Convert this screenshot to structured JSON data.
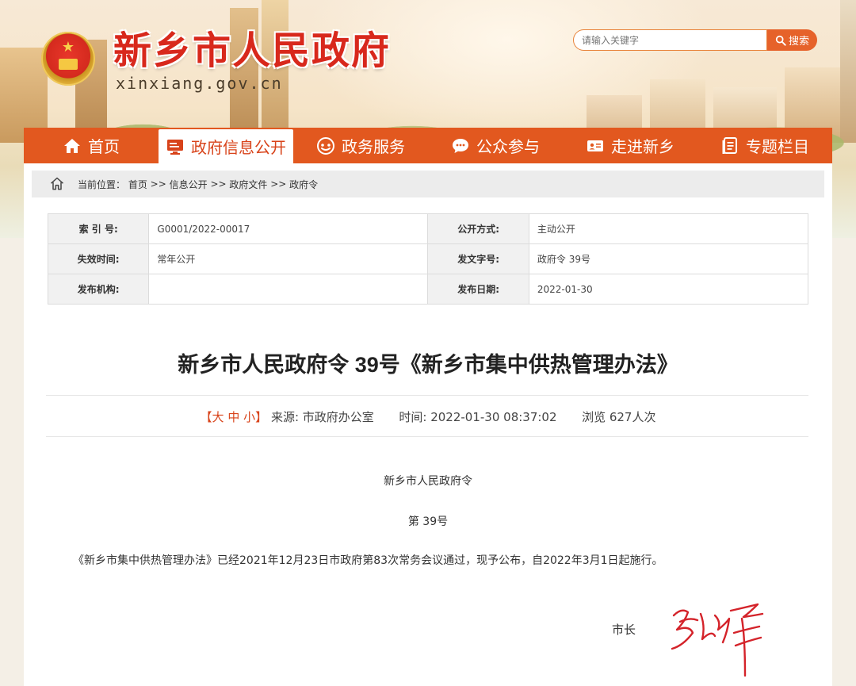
{
  "header": {
    "site_title": "新乡市人民政府",
    "site_domain": "xinxiang.gov.cn",
    "search_placeholder": "请输入关键字",
    "search_button": "搜索"
  },
  "nav": [
    {
      "label": "首页",
      "icon": "home-icon"
    },
    {
      "label": "政府信息公开",
      "icon": "monitor-icon",
      "active": true
    },
    {
      "label": "政务服务",
      "icon": "service-icon"
    },
    {
      "label": "公众参与",
      "icon": "chat-icon"
    },
    {
      "label": "走进新乡",
      "icon": "id-card-icon"
    },
    {
      "label": "专题栏目",
      "icon": "document-icon"
    }
  ],
  "breadcrumb": {
    "prefix": "当前位置：",
    "items": [
      "首页",
      "信息公开",
      "政府文件",
      "政府令"
    ],
    "separator": " >> "
  },
  "meta": {
    "index_label": "索 引 号:",
    "index_value": "G0001/2022-00017",
    "public_mode_label": "公开方式:",
    "public_mode_value": "主动公开",
    "expiry_label": "失效时间:",
    "expiry_value": "常年公开",
    "doc_number_label": "发文字号:",
    "doc_number_value": "政府令 39号",
    "issuer_label": "发布机构:",
    "issuer_value": "",
    "publish_date_label": "发布日期:",
    "publish_date_value": "2022-01-30"
  },
  "article": {
    "title": "新乡市人民政府令 39号《新乡市集中供热管理办法》",
    "font_size_open": "【",
    "font_size_large": "大",
    "font_size_medium": "中",
    "font_size_small": "小",
    "font_size_close": "】",
    "source_label": "来源:",
    "source_value": "市政府办公室",
    "time_label": "时间:",
    "time_value": "2022-01-30 08:37:02",
    "views_text": "浏览 627人次",
    "order_heading": "新乡市人民政府令",
    "order_number": "第 39号",
    "body": "《新乡市集中供热管理办法》已经2021年12月23日市政府第83次常务会议通过，现予公布，自2022年3月1日起施行。",
    "mayor_label": "市长"
  },
  "colors": {
    "nav_bg": "#e2581f",
    "accent": "#d8431a",
    "title_red": "#d8281c"
  }
}
